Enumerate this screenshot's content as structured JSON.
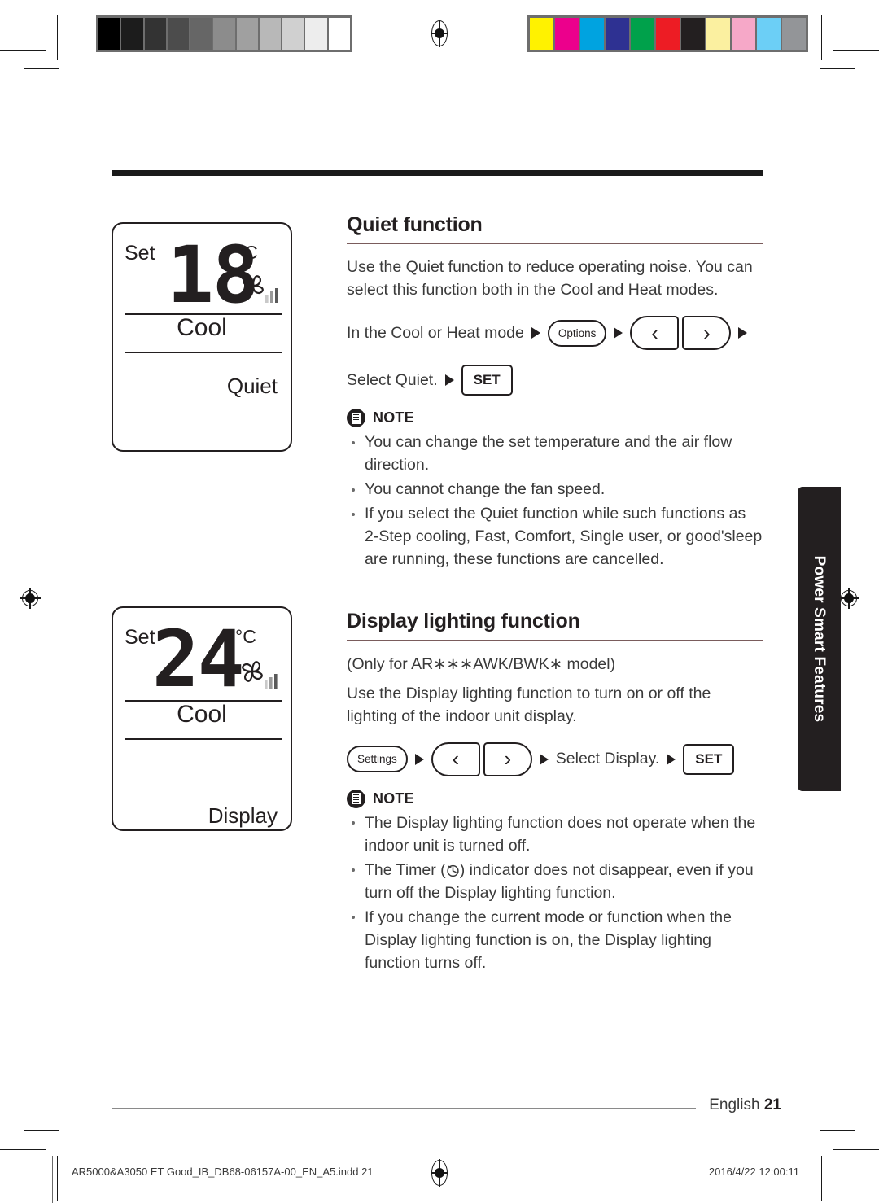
{
  "page": {
    "language_label": "English",
    "page_number": "21",
    "side_tab_label": "Power Smart Features"
  },
  "calibration": {
    "gray_strip": [
      "#000000",
      "#1c1c1c",
      "#333333",
      "#4c4c4c",
      "#666666",
      "#8c8c8c",
      "#a0a0a0",
      "#b8b8b8",
      "#d0d0d0",
      "#ededed",
      "#ffffff"
    ],
    "color_strip": [
      "#fff200",
      "#ec008c",
      "#00a3e0",
      "#2e3192",
      "#00a14b",
      "#ed1c24",
      "#231f20",
      "#fbf0a0",
      "#f6a8c8",
      "#6ccff6",
      "#939598"
    ],
    "strip_border": "#6e6e6e"
  },
  "lcd_quiet": {
    "set_label": "Set",
    "temperature": "18",
    "unit": "°C",
    "mode": "Cool",
    "function": "Quiet",
    "fan_icon": "fan-pinwheel-icon",
    "fan_bars": 3
  },
  "lcd_display": {
    "set_label": "Set",
    "temperature": "24",
    "unit": "°C",
    "mode": "Cool",
    "function": "Display",
    "fan_icon": "fan-pinwheel-icon",
    "fan_bars": 3
  },
  "quiet_section": {
    "title": "Quiet function",
    "intro": "Use the Quiet function to reduce operating noise. You can select this function both in the Cool and Heat modes.",
    "step_row_1_text": "In the Cool or Heat mode",
    "step_row_1_key": "Options",
    "step_row_2_text": "Select Quiet.",
    "step_row_2_key": "SET",
    "arrow_left_glyph": "‹",
    "arrow_right_glyph": "›",
    "note_label": "NOTE",
    "notes": [
      "You can change the set temperature and the air flow direction.",
      "You cannot change the fan speed.",
      "If you select the Quiet function while such functions as 2-Step cooling, Fast, Comfort, Single user, or good'sleep are running, these functions are cancelled."
    ]
  },
  "display_section": {
    "title": "Display lighting function",
    "model_note": "(Only for AR∗∗∗AWK/BWK∗ model)",
    "intro": "Use the Display lighting function to turn on or off the lighting of the indoor unit display.",
    "step_key_settings": "Settings",
    "step_text": "Select Display.",
    "step_key_set": "SET",
    "note_label": "NOTE",
    "notes": [
      {
        "before": "The Display lighting function does not operate when the indoor unit is turned off.",
        "icon": null,
        "after": ""
      },
      {
        "before": "The Timer (",
        "icon": "timer-clock-icon",
        "after": ") indicator does not disappear, even if you turn off the Display lighting function."
      },
      {
        "before": "If you change the current mode or function when the Display lighting function is on, the Display lighting function turns off.",
        "icon": null,
        "after": ""
      }
    ]
  },
  "imprint": {
    "left": "AR5000&A3050 ET Good_IB_DB68-06157A-00_EN_A5.indd   21",
    "right": "2016/4/22   12:00:11"
  }
}
